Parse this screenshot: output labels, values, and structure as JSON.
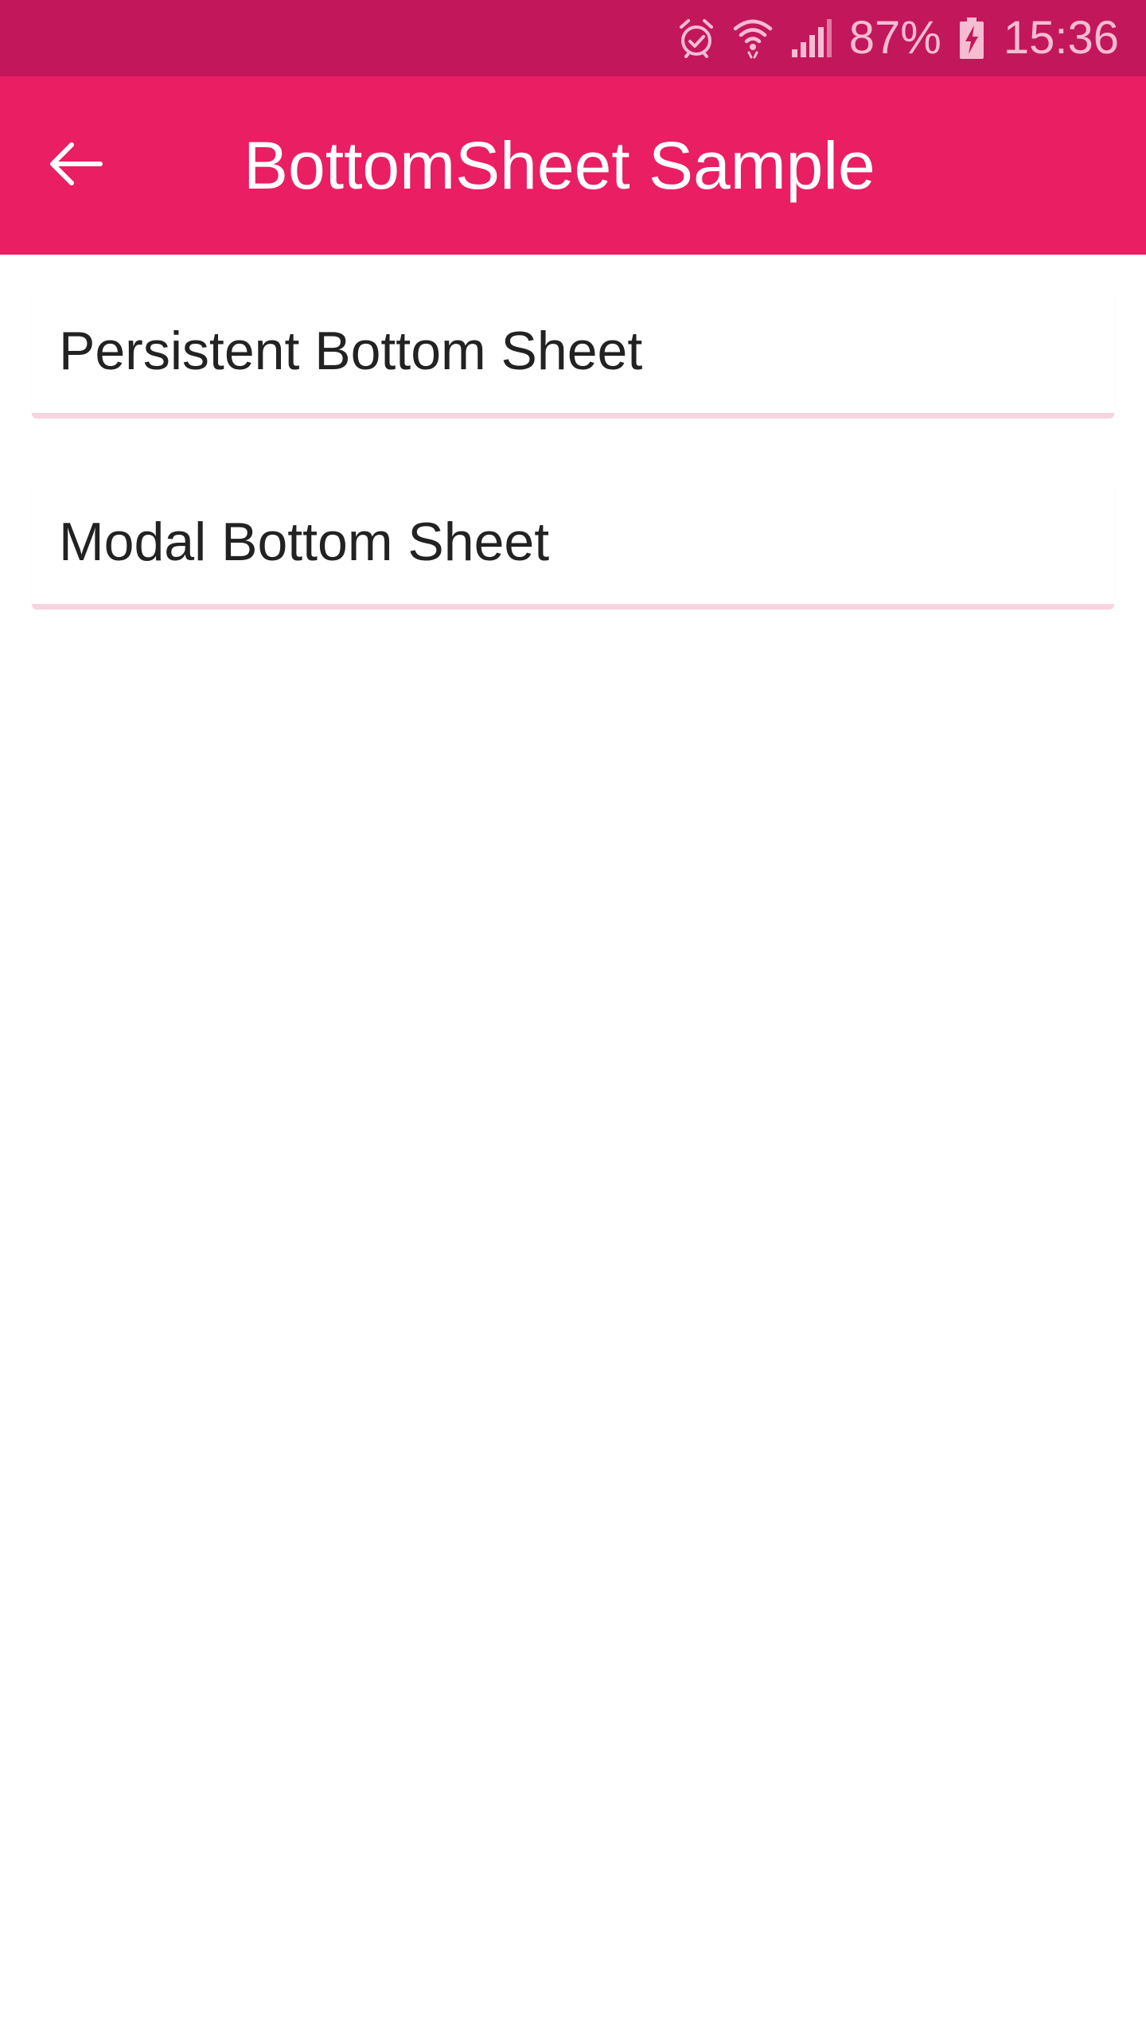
{
  "status_bar": {
    "battery_percent": "87%",
    "time": "15:36",
    "icons": [
      "alarm-icon",
      "wifi-icon",
      "signal-icon",
      "battery-charging-icon"
    ],
    "background_color": "#c2185b"
  },
  "app_bar": {
    "title": "BottomSheet Sample",
    "back_icon": "arrow-left-icon",
    "background_color": "#e91e63"
  },
  "main": {
    "buttons": [
      {
        "label": "Persistent Bottom Sheet"
      },
      {
        "label": "Modal Bottom Sheet"
      }
    ]
  }
}
